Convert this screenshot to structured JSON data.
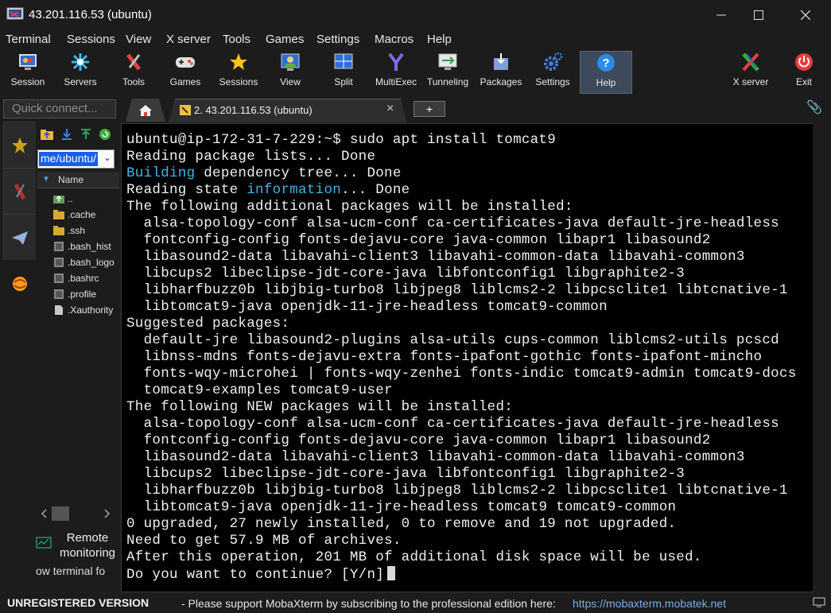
{
  "window": {
    "title": "43.201.116.53 (ubuntu)"
  },
  "menu": [
    "Terminal",
    "Sessions",
    "View",
    "X server",
    "Tools",
    "Games",
    "Settings",
    "Macros",
    "Help"
  ],
  "toolbar": {
    "session": "Session",
    "servers": "Servers",
    "tools": "Tools",
    "games": "Games",
    "sessions": "Sessions",
    "view": "View",
    "split": "Split",
    "multiexec": "MultiExec",
    "tunneling": "Tunneling",
    "packages": "Packages",
    "settings": "Settings",
    "help": "Help",
    "xserver": "X server",
    "exit": "Exit"
  },
  "tabs": {
    "quick_connect_placeholder": "Quick connect...",
    "active_tab": "2. 43.201.116.53 (ubuntu)",
    "new_tab": "+"
  },
  "sidebar": {
    "path": "me/ubuntu/",
    "column": "Name",
    "files": [
      "..",
      ".cache",
      ".ssh",
      ".bash_hist",
      ".bash_logo",
      ".bashrc",
      ".profile",
      ".Xauthority"
    ],
    "remote_monitoring": "Remote monitoring",
    "follow": "ow terminal fo"
  },
  "terminal": {
    "l1": "ubuntu@ip-172-31-7-229:~$ sudo apt install tomcat9",
    "l2": "Reading package lists... Done",
    "l3a": "Building",
    "l3b": " dependency tree... Done",
    "l4a": "Reading state ",
    "l4b": "information",
    "l4c": "... Done",
    "l5": "The following additional packages will be installed:",
    "l6": "  alsa-topology-conf alsa-ucm-conf ca-certificates-java default-jre-headless",
    "l7": "  fontconfig-config fonts-dejavu-core java-common libapr1 libasound2",
    "l8": "  libasound2-data libavahi-client3 libavahi-common-data libavahi-common3",
    "l9": "  libcups2 libeclipse-jdt-core-java libfontconfig1 libgraphite2-3",
    "l10": "  libharfbuzz0b libjbig-turbo8 libjpeg8 liblcms2-2 libpcsclite1 libtcnative-1",
    "l11": "  libtomcat9-java openjdk-11-jre-headless tomcat9-common",
    "l12": "Suggested packages:",
    "l13": "  default-jre libasound2-plugins alsa-utils cups-common liblcms2-utils pcscd",
    "l14": "  libnss-mdns fonts-dejavu-extra fonts-ipafont-gothic fonts-ipafont-mincho",
    "l15": "  fonts-wqy-microhei | fonts-wqy-zenhei fonts-indic tomcat9-admin tomcat9-docs",
    "l16": "  tomcat9-examples tomcat9-user",
    "l17": "The following NEW packages will be installed:",
    "l18": "  alsa-topology-conf alsa-ucm-conf ca-certificates-java default-jre-headless",
    "l19": "  fontconfig-config fonts-dejavu-core java-common libapr1 libasound2",
    "l20": "  libasound2-data libavahi-client3 libavahi-common-data libavahi-common3",
    "l21": "  libcups2 libeclipse-jdt-core-java libfontconfig1 libgraphite2-3",
    "l22": "  libharfbuzz0b libjbig-turbo8 libjpeg8 liblcms2-2 libpcsclite1 libtcnative-1",
    "l23": "  libtomcat9-java openjdk-11-jre-headless tomcat9 tomcat9-common",
    "l24": "0 upgraded, 27 newly installed, 0 to remove and 19 not upgraded.",
    "l25": "Need to get 57.9 MB of archives.",
    "l26": "After this operation, 201 MB of additional disk space will be used.",
    "l27": "Do you want to continue? [Y/n]"
  },
  "status": {
    "unregistered": "UNREGISTERED VERSION",
    "message": "-  Please support MobaXterm by subscribing to the professional edition here:",
    "link": "https://mobaxterm.mobatek.net"
  },
  "colors": {
    "accent": "#3fb6e8",
    "link": "#77aee8",
    "selection": "#1c5ee8"
  }
}
